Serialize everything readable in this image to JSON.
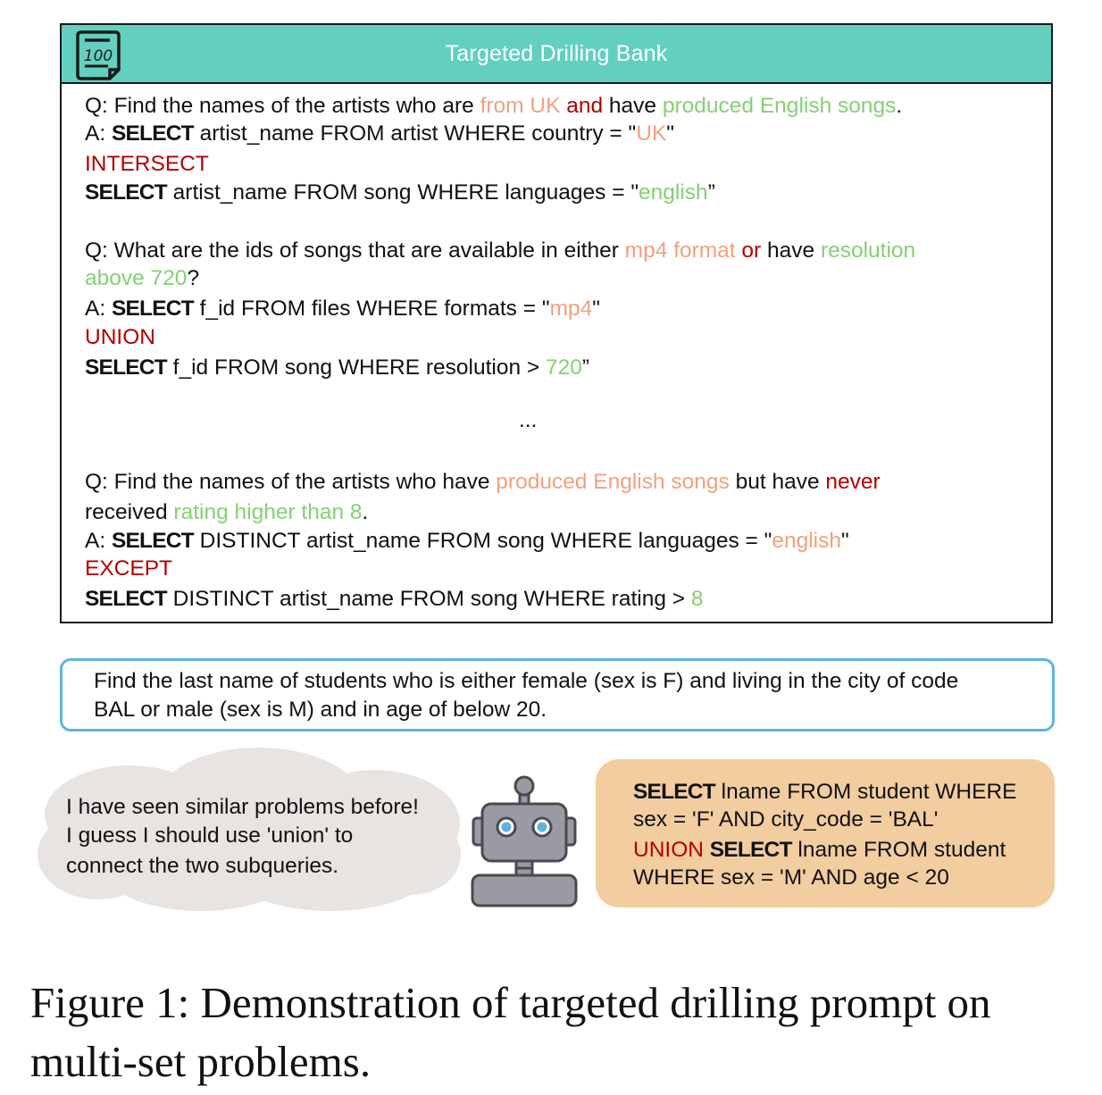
{
  "bank": {
    "title": "Targeted Drilling Bank",
    "icon_text": "100",
    "ellipsis": "...",
    "examples": [
      {
        "q": {
          "p1": "Q: Find the names of the artists who are ",
          "h1": "from UK",
          "sp1": " ",
          "op": "and",
          "p2": " have ",
          "h2": "produced English songs",
          "p3": "."
        },
        "a1": {
          "p1": "A: ",
          "kw": "SELECT",
          "p2": " artist_name FROM artist WHERE country  = \"",
          "h1": "UK",
          "p3": "\""
        },
        "op": "INTERSECT",
        "a2": {
          "kw": "SELECT",
          "p1": " artist_name FROM song WHERE languages  =  \"",
          "h1": "english",
          "p2": "”"
        }
      },
      {
        "q": {
          "p1": "Q: What are the ids of songs that are available in either ",
          "h1": "mp4 format",
          "sp1": " ",
          "op": "or",
          "p2": " have ",
          "h2a": "resolution",
          "h2b": "above 720",
          "p3": "?"
        },
        "a1": {
          "p1": "A: ",
          "kw": "SELECT",
          "p2": " f_id FROM files WHERE formats = \"",
          "h1": "mp4",
          "p3": "\""
        },
        "op": "UNION",
        "a2": {
          "kw": "SELECT",
          "p1": " f_id FROM song WHERE resolution  >  ",
          "h1": "720",
          "p2": "”"
        }
      },
      {
        "q": {
          "p1": "Q: Find the names of the artists who have ",
          "h1": "produced English songs",
          "p2": " but have ",
          "op": "never",
          "p3": "received ",
          "h2": "rating higher than 8",
          "p4": "."
        },
        "a1": {
          "p1": "A: ",
          "kw": "SELECT",
          "p2": " DISTINCT artist_name FROM song WHERE languages  =  \"",
          "h1": "english",
          "p3": "\""
        },
        "op": "EXCEPT",
        "a2": {
          "kw": "SELECT",
          "p1": " DISTINCT artist_name FROM song WHERE rating  >  ",
          "h1": "8"
        }
      }
    ]
  },
  "question": {
    "line1": "Find the last name of students who is either female (sex is F) and living in the city of code",
    "line2": "BAL or male (sex is M) and in age of below 20."
  },
  "thought": {
    "line1": "I have seen similar problems before!",
    "line2": "I guess I should use 'union' to",
    "line3": "connect the two subqueries."
  },
  "answer": {
    "l1": {
      "kw": "SELECT",
      "p1": " lname FROM student WHERE"
    },
    "l2": "sex  =  'F' AND city_code  =  'BAL'",
    "l3": {
      "op": "UNION",
      "sp": " ",
      "kw": "SELECT",
      "p1": " lname FROM student"
    },
    "l4": "WHERE sex  =  'M' AND age  <  20"
  },
  "caption": {
    "line1": "Figure 1: Demonstration of targeted drilling prompt on",
    "line2": "multi-set problems."
  },
  "colors": {
    "header_bg": "#63cfbf",
    "operator": "#b30000",
    "highlight_orange": "#f0a17f",
    "highlight_green": "#86cf76",
    "query_border": "#5bb4e0",
    "answer_bg": "#f2cda0",
    "cloud": "#e8e4e2",
    "robot": "#999aa3"
  }
}
